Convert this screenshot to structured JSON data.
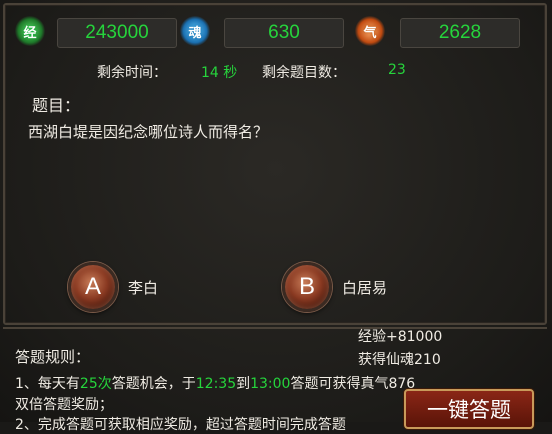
{
  "stats": {
    "exp": {
      "icon": "exp-gem-icon",
      "glyph": "经",
      "value": "243000"
    },
    "soul": {
      "icon": "soul-gem-icon",
      "glyph": "魂",
      "value": "630"
    },
    "qi": {
      "icon": "qi-gem-icon",
      "glyph": "气",
      "value": "2628"
    }
  },
  "info": {
    "time_label": "剩余时间：",
    "time_value": "14 秒",
    "count_label": "剩余题目数：",
    "count_value": "23"
  },
  "question": {
    "label": "题目：",
    "text": "西湖白堤是因纪念哪位诗人而得名？"
  },
  "options": [
    {
      "letter": "A",
      "text": "李白"
    },
    {
      "letter": "B",
      "text": "白居易"
    }
  ],
  "rewards": {
    "exp": "经验+81000",
    "soul": "获得仙魂210"
  },
  "rules": {
    "title": "答题规则：",
    "line1_a": "1、每天有",
    "line1_b": "25次",
    "line1_c": "答题机会，于",
    "line1_d": "12:35",
    "line1_e": "到",
    "line1_f": "13:00",
    "line1_g": "答题可获得真气876",
    "line2": "双倍答题奖励；",
    "line3": "2、完成答题可获取相应奖励，超过答题时间完成答题"
  },
  "buttons": {
    "one_key_answer": "一键答题"
  },
  "colors": {
    "accent_green": "#26d43c",
    "button_red": "#8a2616"
  }
}
